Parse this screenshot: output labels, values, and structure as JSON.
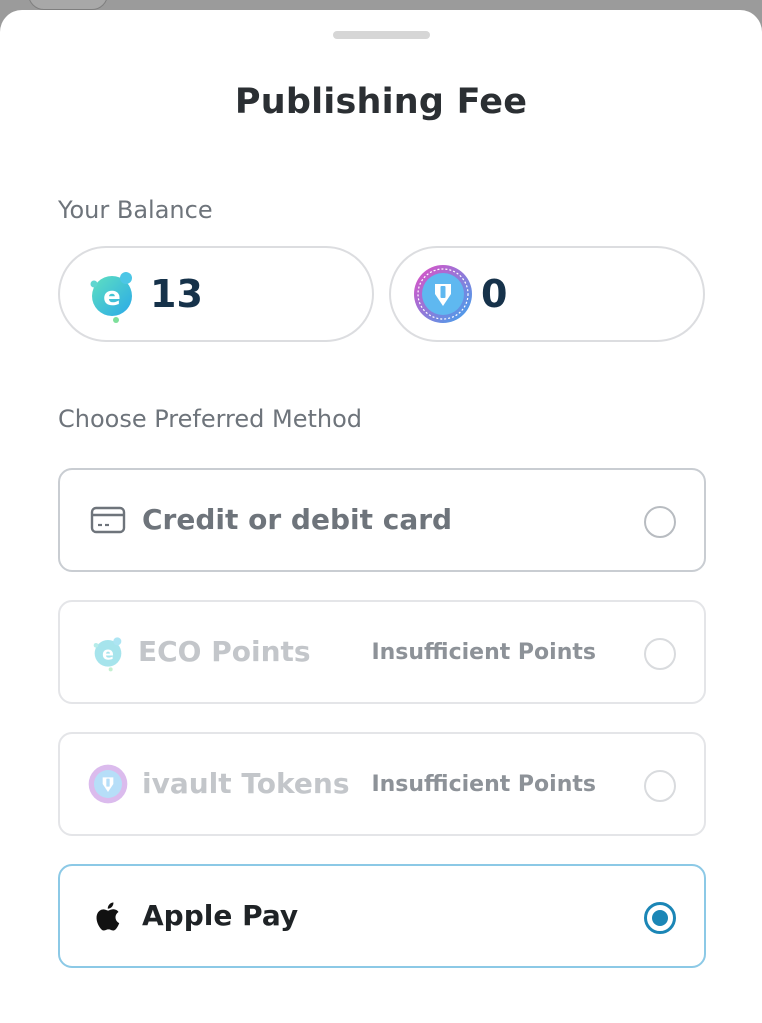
{
  "sheet": {
    "title": "Publishing Fee"
  },
  "balance": {
    "section_label": "Your Balance",
    "eco": {
      "icon": "eco-points-coin-icon",
      "amount": "13"
    },
    "ivault": {
      "icon": "ivault-token-coin-icon",
      "amount": "0"
    }
  },
  "methods": {
    "section_label": "Choose Preferred Method",
    "options": [
      {
        "icon": "credit-card-icon",
        "label": "Credit or debit card",
        "note": "",
        "selected": false,
        "disabled": false
      },
      {
        "icon": "eco-points-coin-icon",
        "label": "ECO Points",
        "note": "Insufficient Points",
        "selected": false,
        "disabled": true
      },
      {
        "icon": "ivault-token-coin-icon",
        "label": "ivault Tokens",
        "note": "Insufficient Points",
        "selected": false,
        "disabled": true
      },
      {
        "icon": "apple-logo-icon",
        "label": "Apple Pay",
        "note": "",
        "selected": true,
        "disabled": false
      }
    ]
  },
  "colors": {
    "accent": "#1b86b6",
    "selected_border": "#8cc9e6",
    "eco_gradient_start": "#4fd6c8",
    "eco_gradient_end": "#2fb4e6",
    "ivault_gradient_start": "#e24bc6",
    "ivault_gradient_end": "#3aa6ee"
  }
}
